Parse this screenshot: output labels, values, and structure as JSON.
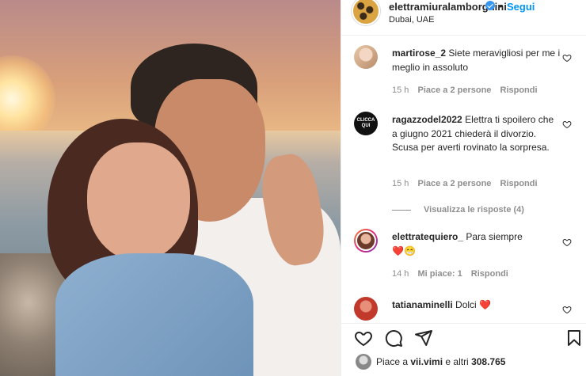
{
  "post": {
    "image_alt": "photo"
  },
  "header": {
    "username": "elettramiuralamborghini",
    "dot": "•",
    "follow_label": "Segui",
    "location": "Dubai, UAE"
  },
  "comments": [
    {
      "username": "martirose_2",
      "text": "Siete meravigliosi per me i meglio in assoluto",
      "time": "15 h",
      "likes": "Piace a 2 persone",
      "reply": "Rispondi"
    },
    {
      "username": "ragazzodel2022",
      "avatar_text": "CLICCA QUI",
      "text": "Elettra ti spoilero che a giugno 2021 chiederà il divorzio. Scusa per averti rovinato la sorpresa.",
      "time": "15 h",
      "likes": "Piace a 2 persone",
      "reply": "Rispondi",
      "view_replies": "Visualizza le risposte (4)"
    },
    {
      "username": "elettratequiero_",
      "text": "Para siempre",
      "emoji": "❤️😁",
      "time": "14 h",
      "likes": "Mi piace: 1",
      "reply": "Rispondi"
    },
    {
      "username": "tatianaminelli",
      "text": "Dolci",
      "emoji": "❤️"
    }
  ],
  "likes_bar": {
    "prefix": "Piace a ",
    "user": "vii.vimi",
    "suffix": " e altri ",
    "count": "308.765"
  },
  "colors": {
    "accent": "#0095f6",
    "heart": "#ed4956",
    "muted": "#8e8e8e"
  }
}
